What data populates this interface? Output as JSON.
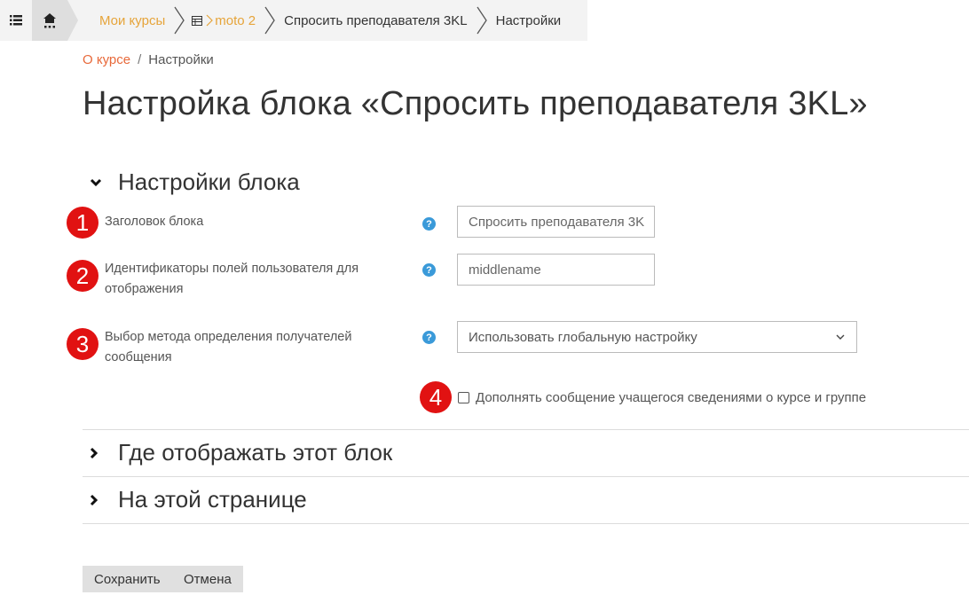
{
  "navbar": {
    "crumbs": [
      {
        "label": "Мои курсы"
      },
      {
        "label": "moto 2"
      },
      {
        "label": "Спросить преподавателя 3KL"
      },
      {
        "label": "Настройки"
      }
    ],
    "icons": [
      "list-icon",
      "home-icon",
      "table-icon"
    ]
  },
  "subcrumb": {
    "link": "О курсе",
    "separator": "/",
    "current": "Настройки"
  },
  "page_title": "Настройка блока «Спросить преподавателя 3KL»",
  "sections": {
    "settings": {
      "title": "Настройки блока",
      "expanded": true
    },
    "where": {
      "title": "Где отображать этот блок",
      "expanded": false
    },
    "on_page": {
      "title": "На этой странице",
      "expanded": false
    }
  },
  "fields": {
    "block_title": {
      "badge": "1",
      "label": "Заголовок блока",
      "value": "Спросить преподавателя 3K"
    },
    "user_fields": {
      "badge": "2",
      "label_line1": "Идентификаторы полей пользователя для",
      "label_line2": "отображения",
      "value": "middlename"
    },
    "recipient_method": {
      "badge": "3",
      "label_line1": "Выбор метода определения получателей",
      "label_line2": "сообщения",
      "selected": "Использовать глобальную настройку"
    },
    "append_info": {
      "badge": "4",
      "label": "Дополнять сообщение учащегося сведениями о курсе и группе",
      "checked": false
    }
  },
  "help_symbol": "?",
  "buttons": {
    "save": "Сохранить",
    "cancel": "Отмена"
  },
  "colors": {
    "link": "#e6a43a",
    "badge": "#e11212",
    "help": "#3a9ad9"
  }
}
